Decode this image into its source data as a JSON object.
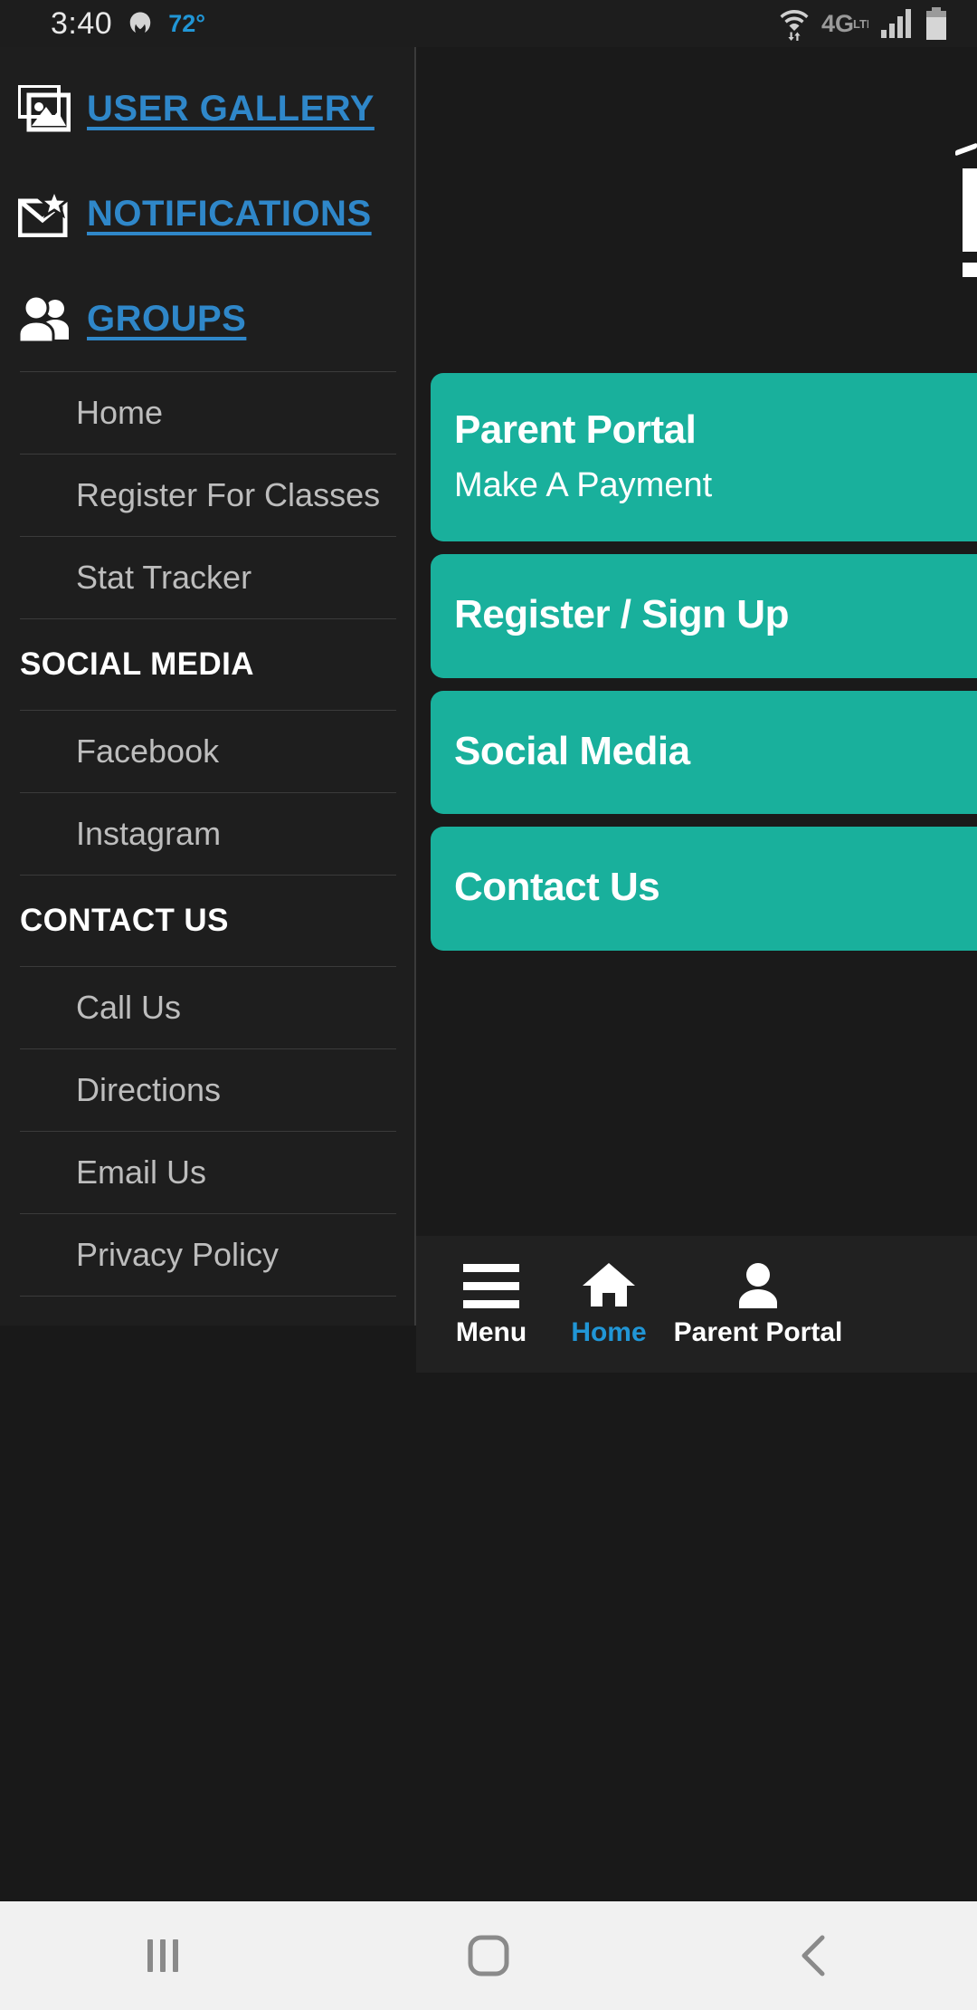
{
  "status_bar": {
    "time": "3:40",
    "temperature": "72°",
    "network_label": "4G",
    "network_sub": "LTE",
    "icons": [
      "malwarebytes-icon",
      "wifi-icon",
      "signal-icon",
      "battery-icon"
    ]
  },
  "drawer": {
    "links": [
      {
        "label": "USER GALLERY",
        "icon": "gallery-icon"
      },
      {
        "label": "NOTIFICATIONS",
        "icon": "envelope-star-icon"
      },
      {
        "label": "GROUPS",
        "icon": "people-icon"
      }
    ],
    "groups_items": [
      "Home",
      "Register For Classes",
      "Stat Tracker"
    ],
    "sections": [
      {
        "title": "SOCIAL MEDIA",
        "items": [
          "Facebook",
          "Instagram"
        ]
      },
      {
        "title": "CONTACT US",
        "items": [
          "Call Us",
          "Directions",
          "Email Us",
          "Privacy Policy"
        ]
      }
    ]
  },
  "cards": [
    {
      "title": "Parent Portal",
      "subtitle": "Make A Payment"
    },
    {
      "title": "Register / Sign Up",
      "subtitle": ""
    },
    {
      "title": "Social Media",
      "subtitle": ""
    },
    {
      "title": "Contact Us",
      "subtitle": ""
    }
  ],
  "bottom_nav": [
    {
      "label": "Menu",
      "icon": "hamburger-icon",
      "active": false
    },
    {
      "label": "Home",
      "icon": "house-icon",
      "active": true
    },
    {
      "label": "Parent Portal",
      "icon": "person-icon",
      "active": false
    }
  ],
  "system_nav": [
    "recents-button",
    "home-button",
    "back-button"
  ],
  "colors": {
    "accent_blue": "#2f87c9",
    "teal": "#19b09c",
    "drawer_bg": "#1e1e1e",
    "page_bg": "#1a1a1a"
  }
}
